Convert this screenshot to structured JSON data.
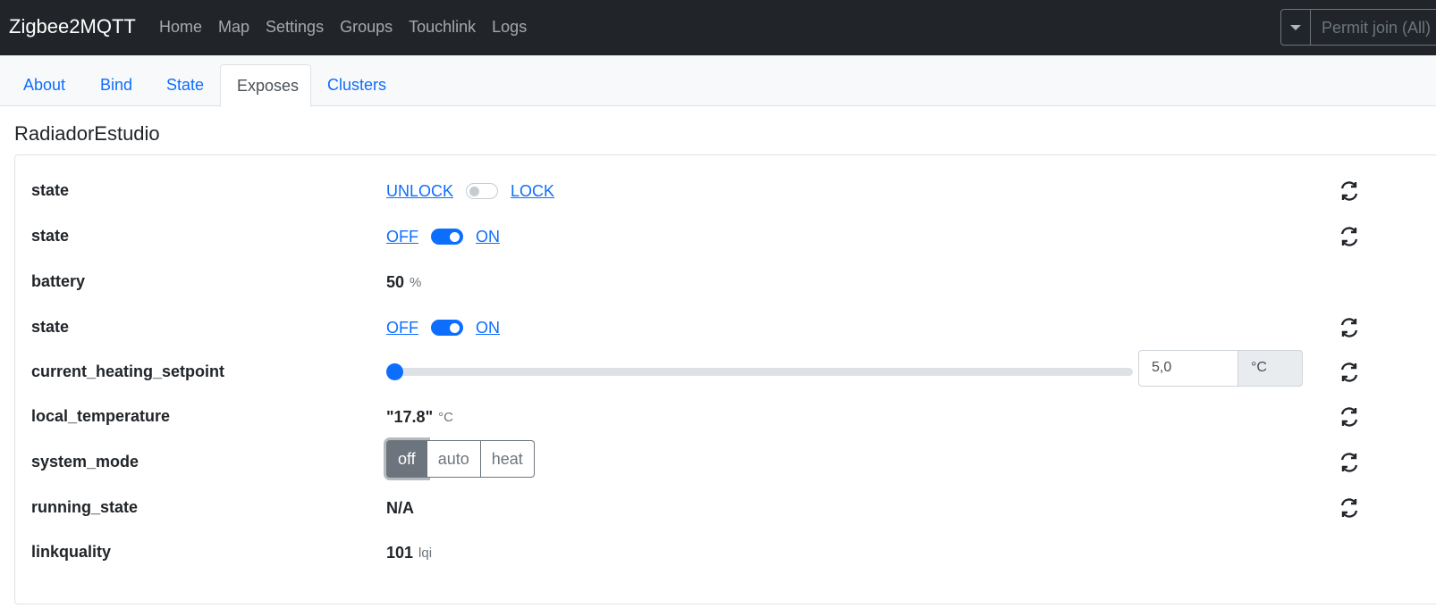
{
  "navbar": {
    "brand": "Zigbee2MQTT",
    "links": [
      "Home",
      "Map",
      "Settings",
      "Groups",
      "Touchlink",
      "Logs"
    ],
    "permit_join": "Permit join (All)"
  },
  "tabs": [
    "About",
    "Bind",
    "State",
    "Exposes",
    "Clusters"
  ],
  "active_tab": "Exposes",
  "device": {
    "name": "RadiadorEstudio"
  },
  "exposes": {
    "lock_state": {
      "label": "state",
      "off_label": "UNLOCK",
      "on_label": "LOCK",
      "checked": false
    },
    "child_lock_state": {
      "label": "state",
      "off_label": "OFF",
      "on_label": "ON",
      "checked": true
    },
    "battery": {
      "label": "battery",
      "value": "50",
      "unit": "%"
    },
    "window_state": {
      "label": "state",
      "off_label": "OFF",
      "on_label": "ON",
      "checked": true
    },
    "setpoint": {
      "label": "current_heating_setpoint",
      "value": "5,0",
      "unit": "°C",
      "fraction": 0.0
    },
    "local_temperature": {
      "label": "local_temperature",
      "value": "\"17.8\"",
      "unit": "°C"
    },
    "system_mode": {
      "label": "system_mode",
      "options": [
        "off",
        "auto",
        "heat"
      ],
      "selected": "off"
    },
    "running_state": {
      "label": "running_state",
      "value": "N/A"
    },
    "linkquality": {
      "label": "linkquality",
      "value": "101",
      "unit": "lqi"
    }
  },
  "icons": {
    "refresh": "refresh-icon",
    "dropdown": "caret-down-icon"
  },
  "colors": {
    "primary": "#0d6efd",
    "navbar": "#212529",
    "secondary": "#6c757d"
  }
}
